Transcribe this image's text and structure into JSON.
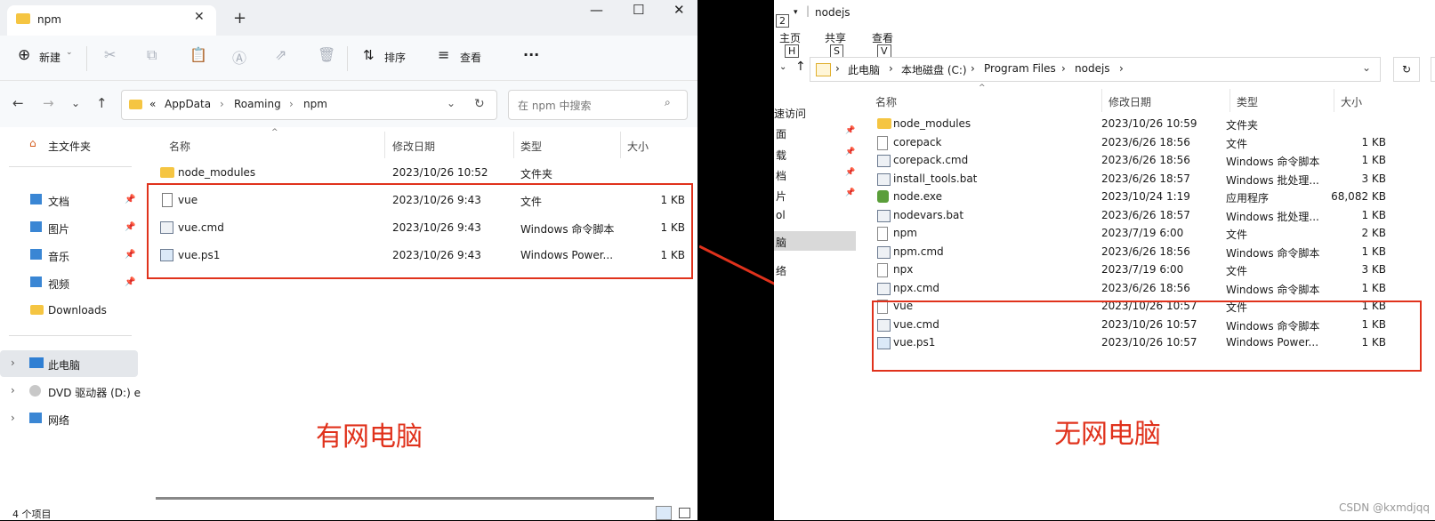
{
  "left": {
    "tab_title": "npm",
    "toolbar": {
      "new_label": "新建",
      "sort_label": "排序",
      "view_label": "查看",
      "more_label": "···"
    },
    "breadcrumb": [
      "«",
      "AppData",
      "›",
      "Roaming",
      "›",
      "npm"
    ],
    "search_placeholder": "在 npm 中搜索",
    "nav": {
      "home": "主文件夹",
      "items": [
        "文档",
        "图片",
        "音乐",
        "视频",
        "Downloads"
      ],
      "this_pc": "此电脑",
      "dvd": "DVD 驱动器 (D:) e",
      "network": "网络"
    },
    "columns": [
      "名称",
      "修改日期",
      "类型",
      "大小"
    ],
    "files": [
      {
        "name": "node_modules",
        "date": "2023/10/26 10:52",
        "type": "文件夹",
        "size": "",
        "icon": "folder-icon"
      },
      {
        "name": "vue",
        "date": "2023/10/26 9:43",
        "type": "文件",
        "size": "1 KB",
        "icon": "file-icon"
      },
      {
        "name": "vue.cmd",
        "date": "2023/10/26 9:43",
        "type": "Windows 命令脚本",
        "size": "1 KB",
        "icon": "cmd-file-icon"
      },
      {
        "name": "vue.ps1",
        "date": "2023/10/26 9:43",
        "type": "Windows Power...",
        "size": "1 KB",
        "icon": "ps1-file-icon"
      }
    ],
    "status": "4 个项目",
    "annotation": "有网电脑"
  },
  "right": {
    "title": "nodejs",
    "quick_num": "2",
    "ribbon": [
      {
        "label": "主页",
        "key": "H"
      },
      {
        "label": "共享",
        "key": "S"
      },
      {
        "label": "查看",
        "key": "V"
      }
    ],
    "breadcrumb": [
      "›",
      "此电脑",
      "›",
      "本地磁盘 (C:)",
      "›",
      "Program Files",
      "›",
      "nodejs",
      "›"
    ],
    "nav_fragments": [
      "速访问",
      "面",
      "载",
      "档",
      "片",
      "ol",
      "脑",
      "络"
    ],
    "columns": [
      "名称",
      "修改日期",
      "类型",
      "大小"
    ],
    "files": [
      {
        "name": "node_modules",
        "date": "2023/10/26 10:59",
        "type": "文件夹",
        "size": ""
      },
      {
        "name": "corepack",
        "date": "2023/6/26 18:56",
        "type": "文件",
        "size": "1 KB"
      },
      {
        "name": "corepack.cmd",
        "date": "2023/6/26 18:56",
        "type": "Windows 命令脚本",
        "size": "1 KB"
      },
      {
        "name": "install_tools.bat",
        "date": "2023/6/26 18:57",
        "type": "Windows 批处理...",
        "size": "3 KB"
      },
      {
        "name": "node.exe",
        "date": "2023/10/24 1:19",
        "type": "应用程序",
        "size": "68,082 KB"
      },
      {
        "name": "nodevars.bat",
        "date": "2023/6/26 18:57",
        "type": "Windows 批处理...",
        "size": "1 KB"
      },
      {
        "name": "npm",
        "date": "2023/7/19 6:00",
        "type": "文件",
        "size": "2 KB"
      },
      {
        "name": "npm.cmd",
        "date": "2023/6/26 18:56",
        "type": "Windows 命令脚本",
        "size": "1 KB"
      },
      {
        "name": "npx",
        "date": "2023/7/19 6:00",
        "type": "文件",
        "size": "3 KB"
      },
      {
        "name": "npx.cmd",
        "date": "2023/6/26 18:56",
        "type": "Windows 命令脚本",
        "size": "1 KB"
      },
      {
        "name": "vue",
        "date": "2023/10/26 10:57",
        "type": "文件",
        "size": "1 KB"
      },
      {
        "name": "vue.cmd",
        "date": "2023/10/26 10:57",
        "type": "Windows 命令脚本",
        "size": "1 KB"
      },
      {
        "name": "vue.ps1",
        "date": "2023/10/26 10:57",
        "type": "Windows Power...",
        "size": "1 KB"
      }
    ],
    "annotation": "无网电脑",
    "watermark": "CSDN @kxmdjqq"
  },
  "colors": {
    "highlight_red": "#e0321c",
    "folder_yellow": "#f5c542"
  }
}
